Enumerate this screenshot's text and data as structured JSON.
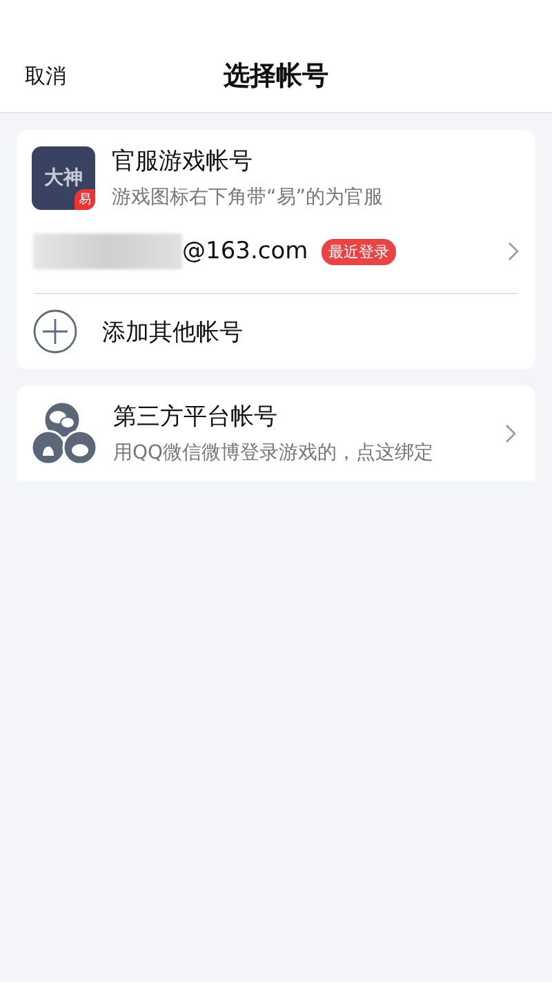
{
  "header": {
    "cancel": "取消",
    "title": "选择帐号"
  },
  "official": {
    "icon_text": "大神",
    "icon_badge": "易",
    "title": "官服游戏帐号",
    "subtitle": "游戏图标右下角带“易”的为官服"
  },
  "account": {
    "email_suffix": "@163.com",
    "badge": "最近登录"
  },
  "add": {
    "label": "添加其他帐号"
  },
  "third_party": {
    "title": "第三方平台帐号",
    "subtitle": "用QQ微信微博登录游戏的，点这绑定"
  }
}
